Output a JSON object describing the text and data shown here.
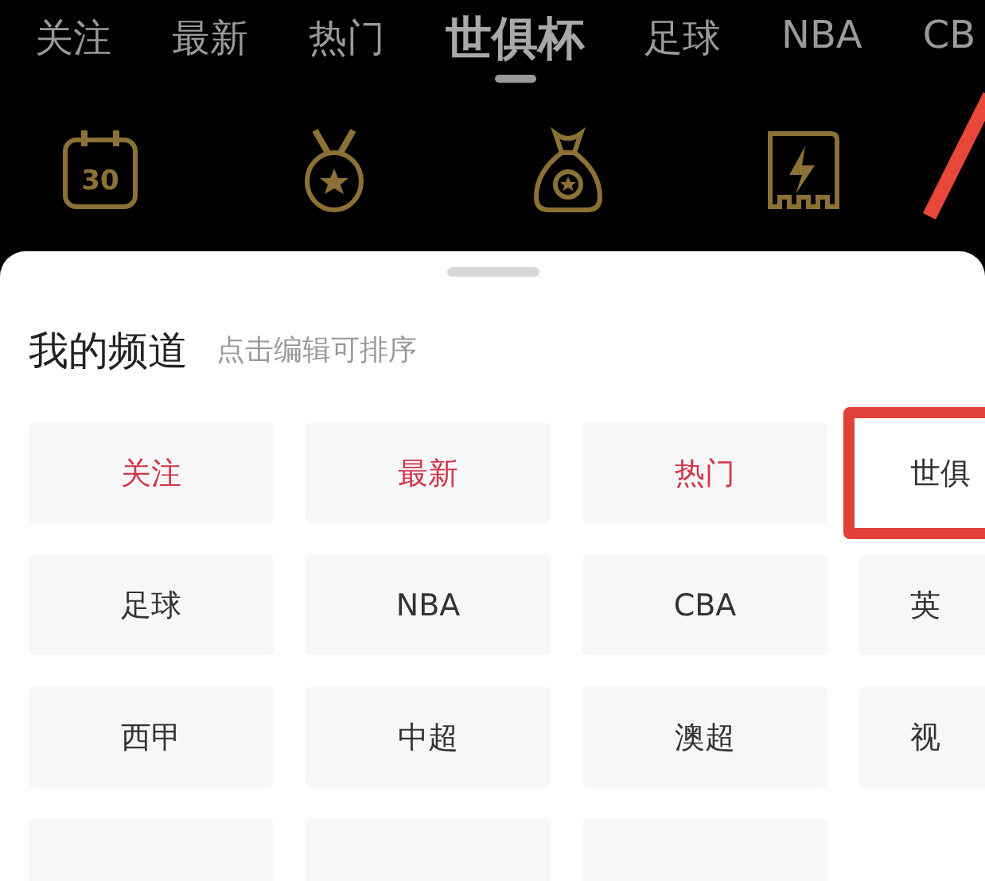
{
  "tabs": [
    {
      "label": "关注",
      "selected": false
    },
    {
      "label": "最新",
      "selected": false
    },
    {
      "label": "热门",
      "selected": false
    },
    {
      "label": "世俱杯",
      "selected": true
    },
    {
      "label": "足球",
      "selected": false
    },
    {
      "label": "NBA",
      "selected": false
    },
    {
      "label": "CB",
      "selected": false
    }
  ],
  "shortcuts": [
    {
      "kind": "calendar",
      "text": "30"
    },
    {
      "kind": "medal"
    },
    {
      "kind": "bag"
    },
    {
      "kind": "card"
    }
  ],
  "annotation_arrow": true,
  "sheet": {
    "title": "我的频道",
    "hint": "点击编辑可排序",
    "channels": [
      {
        "kind": "labeled",
        "label": "关注",
        "color": "#d0364a",
        "highlighted": false
      },
      {
        "kind": "labeled",
        "label": "最新",
        "color": "#d0364a",
        "highlighted": false
      },
      {
        "kind": "labeled",
        "label": "热门",
        "color": "#d0364a",
        "highlighted": false
      },
      {
        "kind": "labeled",
        "label": "世俱",
        "color": "#333333",
        "highlighted": true
      },
      {
        "kind": "labeled",
        "label": "足球",
        "color": "#333333",
        "highlighted": false
      },
      {
        "kind": "labeled",
        "label": "NBA",
        "color": "#333333",
        "highlighted": false
      },
      {
        "kind": "labeled",
        "label": "CBA",
        "color": "#333333",
        "highlighted": false
      },
      {
        "kind": "labeled",
        "label": "英",
        "color": "#333333",
        "highlighted": false
      },
      {
        "kind": "labeled",
        "label": "西甲",
        "color": "#333333",
        "highlighted": false
      },
      {
        "kind": "labeled",
        "label": "中超",
        "color": "#333333",
        "highlighted": false
      },
      {
        "kind": "labeled",
        "label": "澳超",
        "color": "#333333",
        "highlighted": false
      },
      {
        "kind": "labeled",
        "label": "视",
        "color": "#333333",
        "highlighted": false
      },
      {
        "kind": "cut_off"
      },
      {
        "kind": "cut_off"
      },
      {
        "kind": "cut_off"
      }
    ]
  }
}
